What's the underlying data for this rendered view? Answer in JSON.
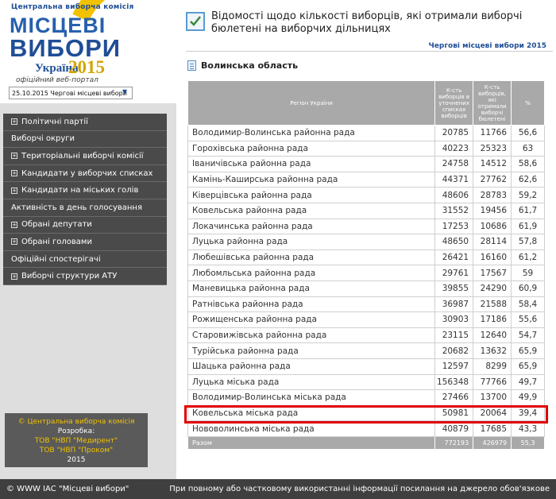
{
  "logo": {
    "cvk_text": "Центральна виборча комісія",
    "line1": "МІСЦЕВІ",
    "line2": "ВИБОРИ",
    "country": "Україна",
    "year": "2015",
    "portal": "офіційний веб-портал"
  },
  "election_select": {
    "value": "25.10.2015 Чергові місцеві вибори"
  },
  "menu": {
    "items": [
      {
        "label": "Політичні партії",
        "expandable": true
      },
      {
        "label": "Виборчі округи",
        "expandable": false
      },
      {
        "label": "Територіальні виборчі комісії",
        "expandable": true
      },
      {
        "label": "Кандидати у виборчих списках",
        "expandable": true
      },
      {
        "label": "Кандидати на міських голів",
        "expandable": true
      },
      {
        "label": "Активність в день голосування",
        "expandable": false
      },
      {
        "label": "Обрані депутати",
        "expandable": true
      },
      {
        "label": "Обрані головами",
        "expandable": true
      },
      {
        "label": "Офіційні спостерігачі",
        "expandable": false
      },
      {
        "label": "Виборчі структури АТУ",
        "expandable": true
      }
    ]
  },
  "credits": {
    "copyright": "© Центральна виборча комісія",
    "dev_label": "Розробка:",
    "dev1": "ТОВ \"НВП \"Медирент\"",
    "dev2": "ТОВ \"НВП \"Проком\"",
    "year": "2015"
  },
  "header": {
    "title": "Відомості щодо кількості виборців, які отримали виборчі бюлетені на виборчих дільницях",
    "election_name": "Чергові місцеві вибори 2015"
  },
  "region_title": "Волинська область",
  "table": {
    "headers": {
      "region": "Регіон України",
      "voters": "К-сть виборців в уточнених списках виборців",
      "received": "К-сть виборців, які отримали виборчі бюлетені",
      "pct": "%"
    },
    "rows": [
      {
        "name": "Володимир-Волинська районна рада",
        "voters": "20785",
        "received": "11766",
        "pct": "56,6"
      },
      {
        "name": "Горохівська районна рада",
        "voters": "40223",
        "received": "25323",
        "pct": "63"
      },
      {
        "name": "Іваничівська районна рада",
        "voters": "24758",
        "received": "14512",
        "pct": "58,6"
      },
      {
        "name": "Камінь-Каширська районна рада",
        "voters": "44371",
        "received": "27762",
        "pct": "62,6"
      },
      {
        "name": "Ківерцівська районна рада",
        "voters": "48606",
        "received": "28783",
        "pct": "59,2"
      },
      {
        "name": "Ковельська районна рада",
        "voters": "31552",
        "received": "19456",
        "pct": "61,7"
      },
      {
        "name": "Локачинська районна рада",
        "voters": "17253",
        "received": "10686",
        "pct": "61,9"
      },
      {
        "name": "Луцька районна рада",
        "voters": "48650",
        "received": "28114",
        "pct": "57,8"
      },
      {
        "name": "Любешівська районна рада",
        "voters": "26421",
        "received": "16160",
        "pct": "61,2"
      },
      {
        "name": "Любомльська районна рада",
        "voters": "29761",
        "received": "17567",
        "pct": "59"
      },
      {
        "name": "Маневицька районна рада",
        "voters": "39855",
        "received": "24290",
        "pct": "60,9"
      },
      {
        "name": "Ратнівська районна рада",
        "voters": "36987",
        "received": "21588",
        "pct": "58,4"
      },
      {
        "name": "Рожищенська районна рада",
        "voters": "30903",
        "received": "17186",
        "pct": "55,6"
      },
      {
        "name": "Старовижівська районна рада",
        "voters": "23115",
        "received": "12640",
        "pct": "54,7"
      },
      {
        "name": "Турійська районна рада",
        "voters": "20682",
        "received": "13632",
        "pct": "65,9"
      },
      {
        "name": "Шацька районна рада",
        "voters": "12597",
        "received": "8299",
        "pct": "65,9"
      },
      {
        "name": "Луцька міська рада",
        "voters": "156348",
        "received": "77766",
        "pct": "49,7"
      },
      {
        "name": "Володимир-Волинська міська рада",
        "voters": "27466",
        "received": "13700",
        "pct": "49,9"
      },
      {
        "name": "Ковельська міська рада",
        "voters": "50981",
        "received": "20064",
        "pct": "39,4"
      },
      {
        "name": "Нововолинська міська рада",
        "voters": "40879",
        "received": "17685",
        "pct": "43,3"
      }
    ],
    "total": {
      "name": "Разом",
      "voters": "772193",
      "received": "426979",
      "pct": "55,3"
    }
  },
  "footer": {
    "left": "© WWW ІАС \"Місцеві вибори\"",
    "right": "При повному або частковому використанні інформації посилання на джерело обов'язкове"
  },
  "colors": {
    "accent": "#1f4e96",
    "highlight": "#e00000",
    "menu_bg": "#4a4a4a",
    "table_header": "#a9a9a9"
  }
}
